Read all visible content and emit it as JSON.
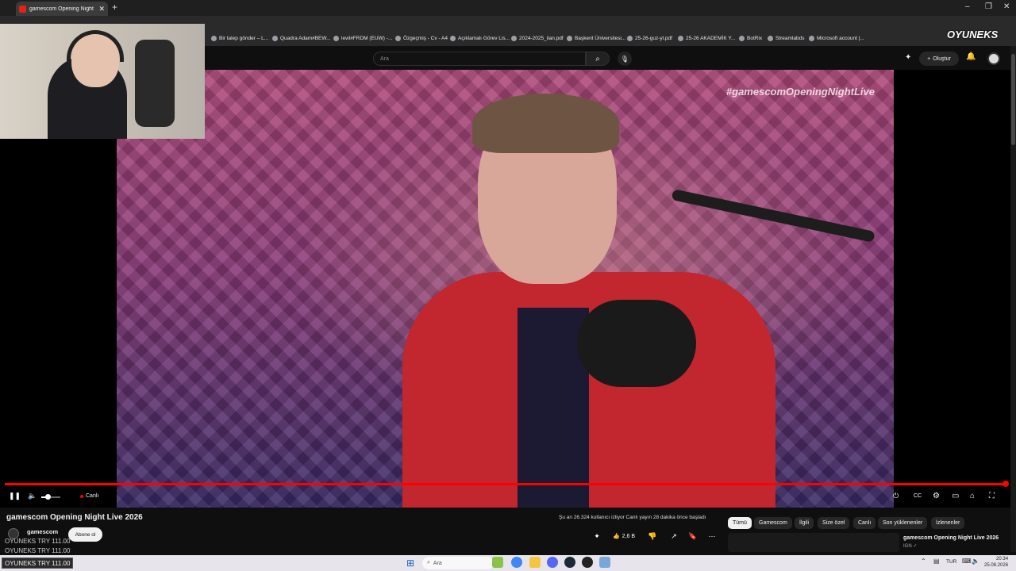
{
  "browser": {
    "tab_title": "gamescom Opening Night Live 2026",
    "tab_close": "✕",
    "new_tab": "+",
    "window_controls": [
      "–",
      "❐",
      "✕"
    ],
    "bookmarks": [
      "Bir talep gönder – L...",
      "Quadra Adam#BEW...",
      "levil#FRDM (EUW) -...",
      "Özgeçmiş - Cv - A4",
      "Açıklamalı Görev Lis...",
      "2024-2025_ilan.pdf",
      "Başkent Üniversitesi...",
      "25-26-guz-yl.pdf",
      "25-26 AKADEMİK Y...",
      "BotRix",
      "Streamlabds",
      "Microsoft account |..."
    ]
  },
  "masthead": {
    "search_placeholder": "Ara",
    "search_icon": "⌕",
    "mic_icon": "🎙",
    "create_label": "Oluştur",
    "create_plus": "+",
    "bell_icon": "🔔"
  },
  "overlay": {
    "logo": "OYUNEKS",
    "ticker_1": "OYUNEKS  TRY 111.00",
    "ticker_2": "OYUNEKS  TRY 111.00",
    "ticker_taskbar": "OYUNEKS  TRY 111.00"
  },
  "video": {
    "hashtag": "#gamescomOpeningNightLive",
    "live_label": "Canlı",
    "progress_fraction": 1.0,
    "volume_fraction": 0.35,
    "play_pause_icon": "❚❚",
    "volume_icon": "🔈",
    "autoplay_icon": "⏻",
    "captions_icon": "CC",
    "settings_icon": "⚙",
    "theater_icon": "▭",
    "cast_icon": "⌂",
    "fullscreen_icon": "⛶"
  },
  "details": {
    "title": "gamescom Opening Night Live 2026",
    "viewers": "Şu an 26.324 kullanıcı izliyor  Canlı yayın 28 dakika önce başladı",
    "channel_name": "gamescom",
    "subscribe_label": "Abone ol",
    "like_count": "2,6 B",
    "like_icon": "👍",
    "dislike_icon": "👎",
    "share_icon": "↗",
    "save_icon": "🔖",
    "more_icon": "⋯"
  },
  "chips": [
    "Tümü",
    "Gamescom",
    "İlgili",
    "Size özel",
    "Canlı",
    "Son yüklenenler",
    "İzlenenler"
  ],
  "recommendation": {
    "title": "gamescom Opening Night Live 2026",
    "channel": "IGN ✓"
  },
  "taskbar": {
    "search_placeholder": "Ara",
    "language": "TUR",
    "time": "20:34",
    "date": "25.08.2026"
  }
}
